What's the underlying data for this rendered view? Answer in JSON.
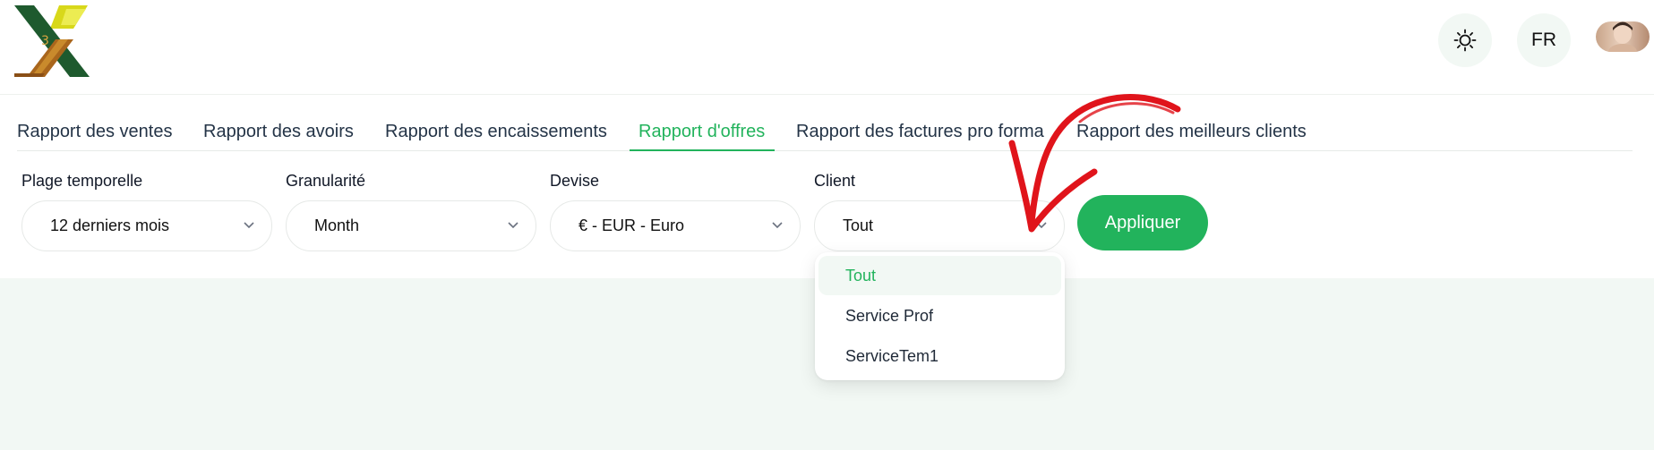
{
  "header": {
    "logo_icon": "x-logo-icon",
    "theme_icon": "sun-icon",
    "language": "FR",
    "avatar_icon": "user-avatar"
  },
  "tabs": [
    {
      "label": "Rapport des ventes",
      "active": false
    },
    {
      "label": "Rapport des avoirs",
      "active": false
    },
    {
      "label": "Rapport des encaissements",
      "active": false
    },
    {
      "label": "Rapport d'offres",
      "active": true
    },
    {
      "label": "Rapport des factures pro forma",
      "active": false
    },
    {
      "label": "Rapport des meilleurs clients",
      "active": false
    }
  ],
  "filters": {
    "time_range": {
      "label": "Plage temporelle",
      "value": "12 derniers mois"
    },
    "granularity": {
      "label": "Granularité",
      "value": "Month"
    },
    "currency": {
      "label": "Devise",
      "value": "€ - EUR - Euro"
    },
    "client": {
      "label": "Client",
      "value": "Tout"
    }
  },
  "apply_label": "Appliquer",
  "client_dropdown": {
    "options": [
      "Tout",
      "Service Prof",
      "ServiceTem1"
    ],
    "selected": "Tout"
  },
  "colors": {
    "accent": "#22b35c",
    "background": "#f2f8f4",
    "annotation_arrow": "#e0141b"
  }
}
